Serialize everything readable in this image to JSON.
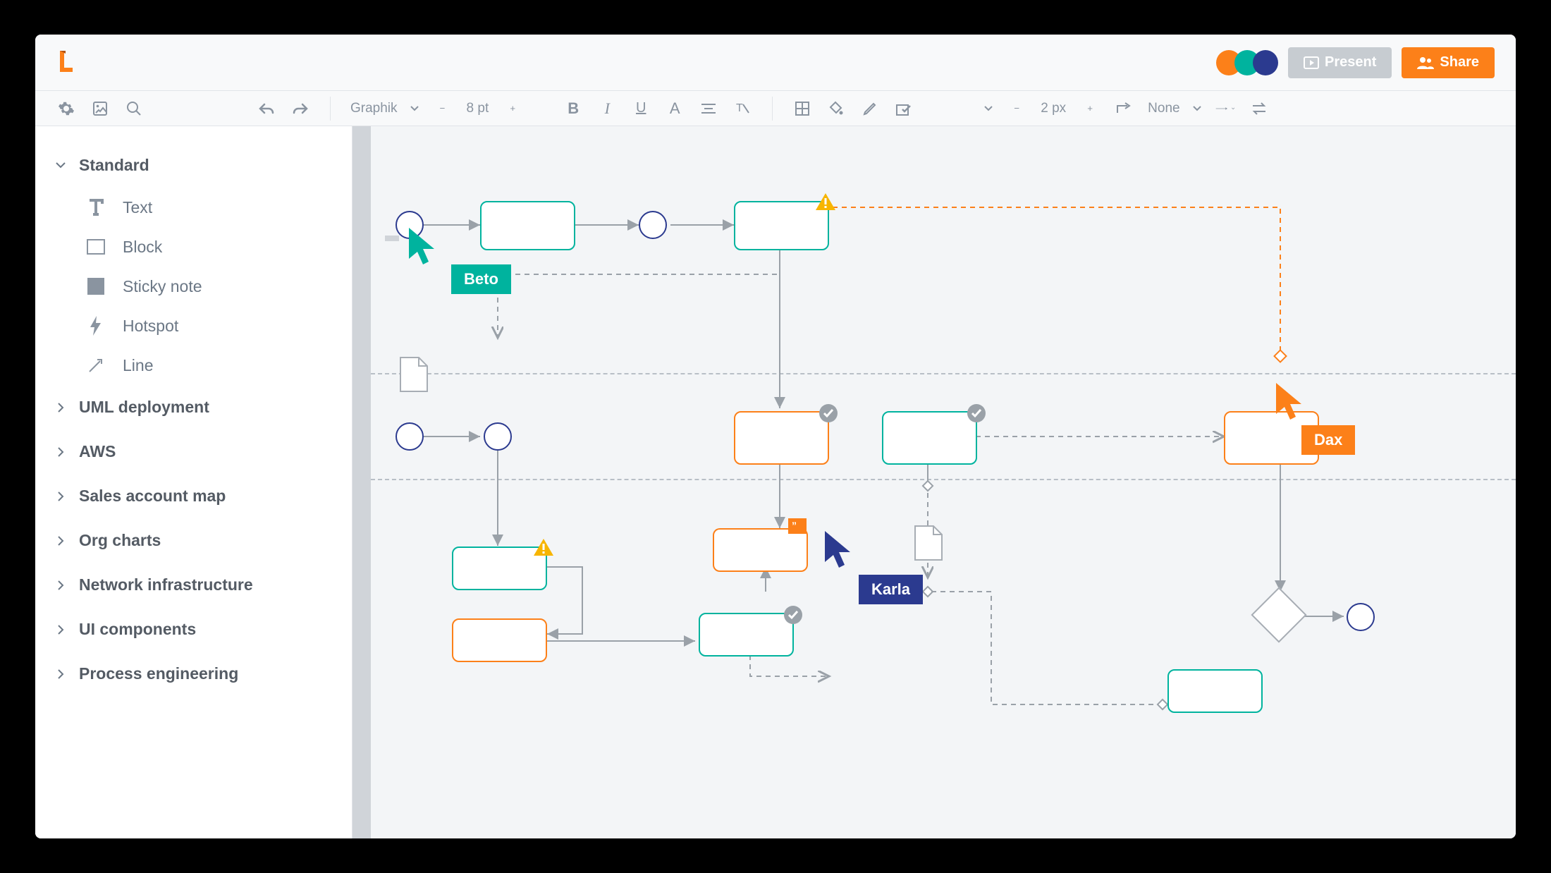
{
  "header": {
    "present_label": "Present",
    "share_label": "Share"
  },
  "avatars": [
    {
      "color": "#fc8019"
    },
    {
      "color": "#00b39e"
    },
    {
      "color": "#2b3a8f"
    }
  ],
  "toolbar": {
    "font_name": "Graphik",
    "font_size": "8 pt",
    "line_width": "2 px",
    "line_style_label": "None"
  },
  "sidebar": {
    "expanded": {
      "label": "Standard",
      "items": [
        {
          "id": "text",
          "label": "Text"
        },
        {
          "id": "block",
          "label": "Block"
        },
        {
          "id": "sticky",
          "label": "Sticky note"
        },
        {
          "id": "hotspot",
          "label": "Hotspot"
        },
        {
          "id": "line",
          "label": "Line"
        }
      ]
    },
    "collapsed": [
      "UML deployment",
      "AWS",
      "Sales account map",
      "Org charts",
      "Network infrastructure",
      "UI components",
      "Process engineering"
    ]
  },
  "cursors": {
    "beto": {
      "label": "Beto",
      "color": "#00b39e"
    },
    "karla": {
      "label": "Karla",
      "color": "#2b3a8f"
    },
    "dax": {
      "label": "Dax",
      "color": "#fc8019"
    }
  },
  "colors": {
    "teal": "#00b39e",
    "orange": "#fc8019",
    "navy": "#2b3a8f",
    "gray": "#a7adb4"
  }
}
